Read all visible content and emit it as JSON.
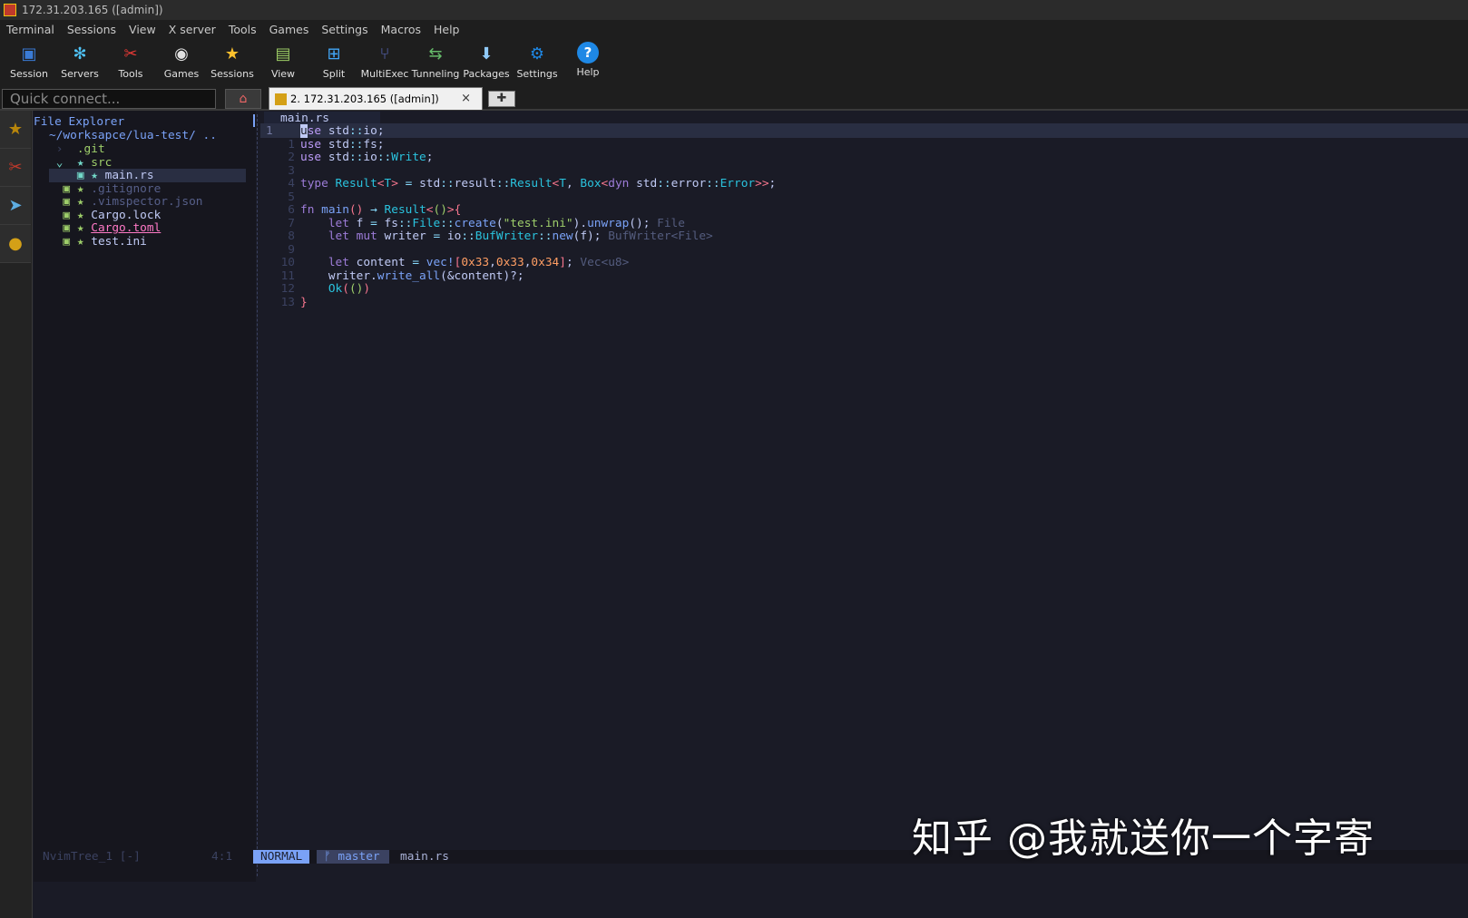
{
  "window": {
    "title": "172.31.203.165 ([admin])"
  },
  "menu": [
    "Terminal",
    "Sessions",
    "View",
    "X server",
    "Tools",
    "Games",
    "Settings",
    "Macros",
    "Help"
  ],
  "toolbar": [
    {
      "label": "Session",
      "icon": "session-icon",
      "color": "#3a7bd5"
    },
    {
      "label": "Servers",
      "icon": "servers-icon",
      "color": "#4fc3f7"
    },
    {
      "label": "Tools",
      "icon": "tools-icon",
      "color": "#e53935"
    },
    {
      "label": "Games",
      "icon": "games-icon",
      "color": "#e0e0e0"
    },
    {
      "label": "Sessions",
      "icon": "star-icon",
      "color": "#fbc02d"
    },
    {
      "label": "View",
      "icon": "view-icon",
      "color": "#9ccc65"
    },
    {
      "label": "Split",
      "icon": "split-icon",
      "color": "#42a5f5"
    },
    {
      "label": "MultiExec",
      "icon": "multiexec-icon",
      "color": "#5c6bc0"
    },
    {
      "label": "Tunneling",
      "icon": "tunneling-icon",
      "color": "#66bb6a"
    },
    {
      "label": "Packages",
      "icon": "packages-icon",
      "color": "#90caf9"
    },
    {
      "label": "Settings",
      "icon": "settings-icon",
      "color": "#1e88e5"
    },
    {
      "label": "Help",
      "icon": "help-icon",
      "color": "#1e88e5"
    }
  ],
  "tabs": {
    "quick_connect_placeholder": "Quick connect...",
    "session_tab": "2. 172.31.203.165 ([admin])",
    "close_symbol": "×",
    "new_tab_symbol": "✚"
  },
  "tree": {
    "title": "File Explorer",
    "root": "~/worksapce/lua-test/ ..",
    "items": [
      {
        "prefix": " ›  ",
        "name": ".git",
        "marked": false
      },
      {
        "prefix": " ⌄  ★ ",
        "name": "src",
        "marked": false
      },
      {
        "prefix": "    ▣ ★ ",
        "name": "main.rs",
        "marked": false
      },
      {
        "prefix": "  ▣ ★ ",
        "name": ".gitignore",
        "marked": false
      },
      {
        "prefix": "  ▣ ★ ",
        "name": ".vimspector.json",
        "marked": false
      },
      {
        "prefix": "  ▣ ★ ",
        "name": "Cargo.lock",
        "marked": false
      },
      {
        "prefix": "  ▣ ★ ",
        "name": "Cargo.toml",
        "marked": true
      },
      {
        "prefix": "  ▣ ★ ",
        "name": "test.ini",
        "marked": false
      }
    ]
  },
  "editor": {
    "tab": "main.rs",
    "line_numbers": [
      "1",
      "1",
      "2",
      "3",
      "4",
      "5",
      "6",
      "7",
      "8",
      "9",
      "10",
      "11",
      "12",
      "13"
    ]
  },
  "statusline": {
    "tree": "NvimTree_1 [-]",
    "tree_pos": "4:1",
    "mode": "NORMAL",
    "branch": "ᚠ master",
    "file": "main.rs"
  },
  "watermark": "知乎 @我就送你一个字寄"
}
